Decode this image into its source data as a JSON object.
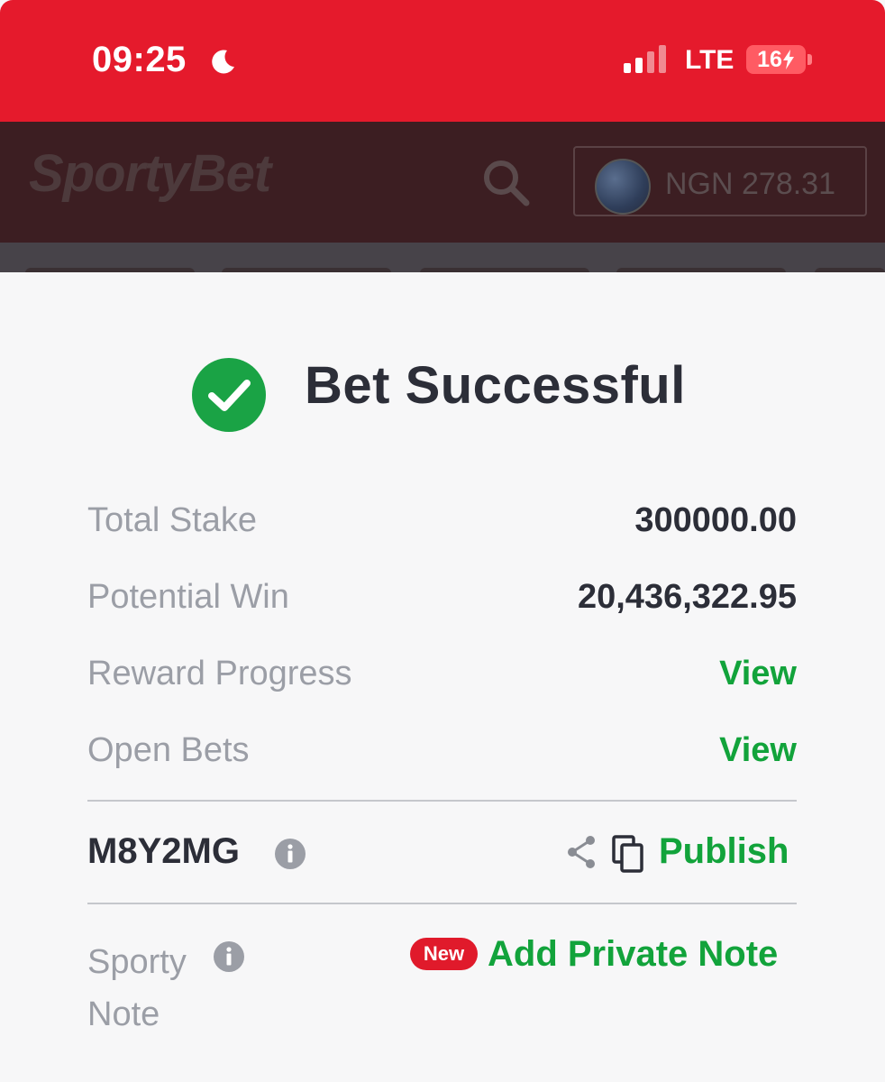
{
  "status_bar": {
    "time": "09:25",
    "network": "LTE",
    "battery": "16",
    "icons": [
      "moon-icon",
      "signal-icon",
      "battery-icon"
    ]
  },
  "header": {
    "logo": "SportyBet",
    "balance": "NGN 278.31",
    "icons": [
      "search-icon"
    ]
  },
  "sheet": {
    "title": "Bet Successful",
    "rows": [
      {
        "label": "Total Stake",
        "value": "300000.00"
      },
      {
        "label": "Potential Win",
        "value": "20,436,322.95"
      },
      {
        "label": "Reward Progress",
        "value": "View"
      },
      {
        "label": "Open Bets",
        "value": "View"
      }
    ],
    "booking_code": "M8Y2MG",
    "publish_label": "Publish",
    "sporty_note_label": "Sporty Note",
    "new_badge": "New",
    "add_note_label": "Add Private Note"
  },
  "colors": {
    "status_red": "#e51a2c",
    "success_green": "#1aa345",
    "link_green": "#12a33b",
    "text_dark": "#2c2e38",
    "text_gray": "#9b9ea6"
  }
}
